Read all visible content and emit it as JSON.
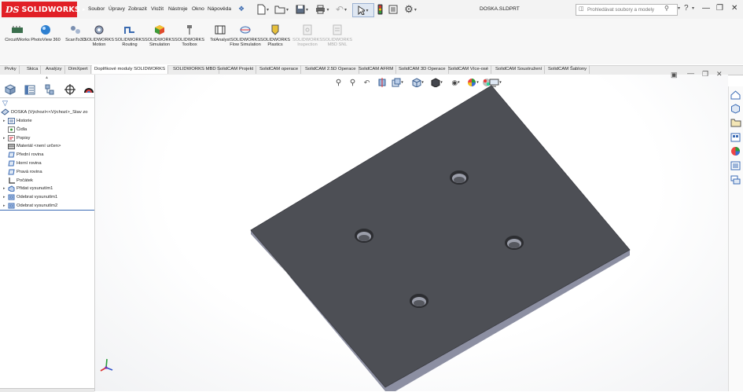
{
  "app": {
    "logo_text": "SOLIDWORKS",
    "logo_mark": "DS"
  },
  "menu": [
    "Soubor",
    "Úpravy",
    "Zobrazit",
    "Vložit",
    "Nástroje",
    "Okno",
    "Nápověda"
  ],
  "document_title": "DOSKA.SLDPRT",
  "search": {
    "placeholder": "Prohledávat soubory a modely"
  },
  "ribbon": [
    {
      "label": "CircuitWorks",
      "icon": "circuitworks-icon",
      "enabled": true
    },
    {
      "label": "PhotoView 360",
      "icon": "photoview-icon",
      "enabled": true
    },
    {
      "label": "ScanTo3D",
      "icon": "scanto3d-icon",
      "enabled": true
    },
    {
      "label": "SOLIDWORKS Motion",
      "icon": "motion-icon",
      "enabled": true
    },
    {
      "label": "SOLIDWORKS Routing",
      "icon": "routing-icon",
      "enabled": true
    },
    {
      "label": "SOLIDWORKS Simulation",
      "icon": "simulation-icon",
      "enabled": true
    },
    {
      "label": "SOLIDWORKS Toolbox",
      "icon": "toolbox-icon",
      "enabled": true
    },
    {
      "label": "TolAnalyst",
      "icon": "tolanalyst-icon",
      "enabled": true
    },
    {
      "label": "SOLIDWORKS Flow Simulation",
      "icon": "flow-simulation-icon",
      "enabled": true
    },
    {
      "label": "SOLIDWORKS Plastics",
      "icon": "plastics-icon",
      "enabled": true
    },
    {
      "label": "SOLIDWORKS Inspection",
      "icon": "inspection-icon",
      "enabled": false
    },
    {
      "label": "SOLIDWORKS MBD SNL",
      "icon": "mbd-snl-icon",
      "enabled": false
    }
  ],
  "tabs": [
    {
      "label": "Prvky",
      "active": false
    },
    {
      "label": "Skica",
      "active": false
    },
    {
      "label": "Analýzy",
      "active": false
    },
    {
      "label": "DimXpert",
      "active": false
    },
    {
      "label": "Doplňkové moduly SOLIDWORKS",
      "active": true
    },
    {
      "label": "SOLIDWORKS MBD",
      "active": false
    },
    {
      "label": "SolidCAM Projekt",
      "active": false
    },
    {
      "label": "SolidCAM operace",
      "active": false
    },
    {
      "label": "SolidCAM 2.5D Operace",
      "active": false
    },
    {
      "label": "SolidCAM AFRM",
      "active": false
    },
    {
      "label": "SolidCAM 3D Operace",
      "active": false
    },
    {
      "label": "SolidCAM Více-osé",
      "active": false
    },
    {
      "label": "SolidCAM Soustružení",
      "active": false
    },
    {
      "label": "SolidCAM Šablony",
      "active": false
    }
  ],
  "tree": {
    "root": "DOSKA  (Výchozí<<Výchozí>_Stav zo",
    "items": [
      {
        "label": "Historie",
        "expandable": true,
        "icon": "history-icon"
      },
      {
        "label": "Čidla",
        "expandable": false,
        "icon": "sensors-icon"
      },
      {
        "label": "Popisy",
        "expandable": true,
        "icon": "annotations-icon"
      },
      {
        "label": "Materiál <není určen>",
        "expandable": false,
        "icon": "material-icon"
      },
      {
        "label": "Přední rovina",
        "expandable": false,
        "icon": "plane-icon"
      },
      {
        "label": "Horní rovina",
        "expandable": false,
        "icon": "plane-icon"
      },
      {
        "label": "Pravá rovina",
        "expandable": false,
        "icon": "plane-icon"
      },
      {
        "label": "Počátek",
        "expandable": false,
        "icon": "origin-icon"
      },
      {
        "label": "Přidat vysunutím1",
        "expandable": true,
        "icon": "extrude-boss-icon"
      },
      {
        "label": "Odebrat vysunutím1",
        "expandable": true,
        "icon": "extrude-cut-icon"
      },
      {
        "label": "Odebrat vysunutím2",
        "expandable": true,
        "icon": "extrude-cut-icon"
      }
    ]
  },
  "colors": {
    "accent_red": "#e11f26",
    "part_top": "#4d4f55",
    "part_side": "#8e91a3",
    "hole_edge": "#2c2d31"
  }
}
